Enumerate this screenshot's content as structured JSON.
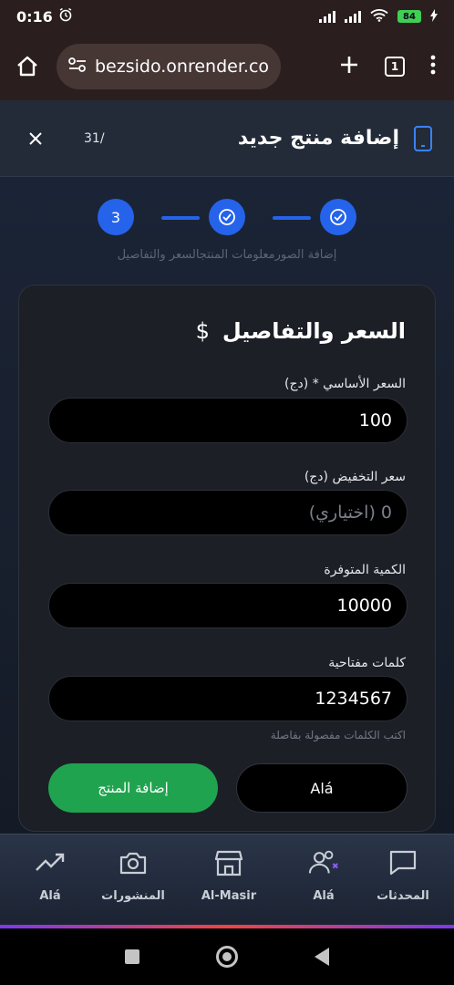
{
  "status_bar": {
    "time": "0:16",
    "battery": "84"
  },
  "browser": {
    "url": "bezsido.onrender.com",
    "tab_count": "1"
  },
  "modal": {
    "title": "إضافة منتج جديد",
    "counter": "31/"
  },
  "stepper": {
    "current_step": "3",
    "labels": "إضافة الصورمعلومات المنتجالسعر والتفاصيل"
  },
  "card": {
    "title": "السعر والتفاصيل",
    "dollar_glyph": "$",
    "fields": [
      {
        "label": "السعر الأساسي * (دج)",
        "value": "100",
        "placeholder": ""
      },
      {
        "label": "سعر التخفيض (دج)",
        "value": "",
        "placeholder": "0 (اختياري)"
      },
      {
        "label": "الكمية المتوفرة",
        "value": "10000",
        "placeholder": ""
      },
      {
        "label": "كلمات مفتاحية",
        "value": "1234567",
        "placeholder": ""
      }
    ],
    "keywords_hint": "اكتب الكلمات مفصولة بفاصلة",
    "cancel_label": "Alá",
    "submit_label": "إضافة المنتج"
  },
  "bottom_nav": {
    "items": [
      {
        "label": "Alá",
        "icon": "trending-up-icon"
      },
      {
        "label": "المنشورات",
        "icon": "camera-icon"
      },
      {
        "label": "Al-Masir",
        "icon": "store-icon"
      },
      {
        "label": "Alá",
        "icon": "users-icon"
      },
      {
        "label": "المحدثات",
        "icon": "chat-bubble-icon"
      }
    ]
  },
  "colors": {
    "accent": "#2563eb",
    "success": "#1fa34f",
    "card_bg": "#1c1f26"
  }
}
